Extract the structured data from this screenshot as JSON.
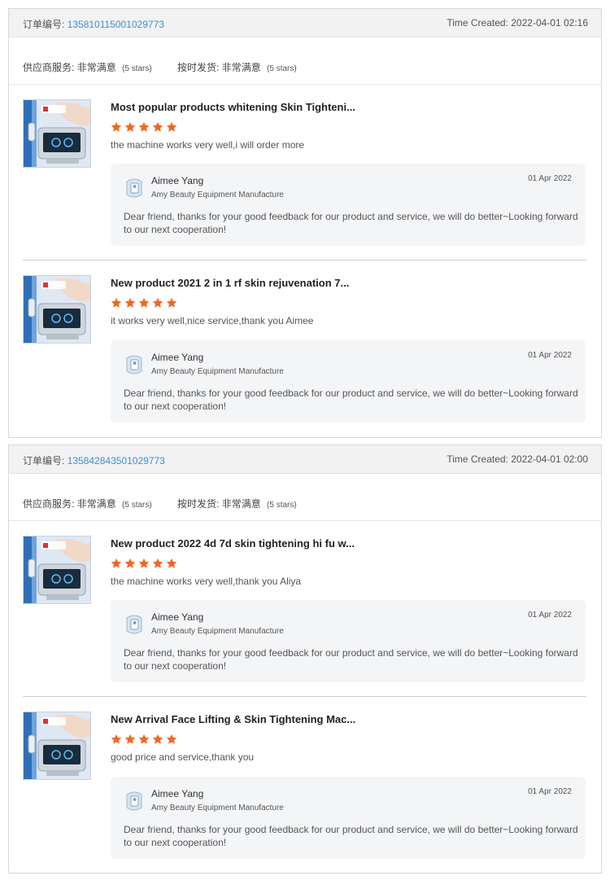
{
  "labels": {
    "order_no_label": "订单编号:",
    "time_created_label": "Time Created:",
    "supplier_service_label": "供应商服务:",
    "on_time_shipping_label": "按时发货:"
  },
  "orders": [
    {
      "order_no": "135810115001029773",
      "time_created": "2022-04-01 02:16",
      "supplier_service": {
        "value": "非常满意",
        "stars_text": "(5 stars)"
      },
      "on_time_shipping": {
        "value": "非常满意",
        "stars_text": "(5 stars)"
      },
      "reviews": [
        {
          "title": "Most popular products whitening Skin Tighteni...",
          "rating": 5,
          "text": "the machine works very well,i will order more",
          "reply": {
            "name": "Aimee Yang",
            "company": "Amy Beauty Equipment Manufacture",
            "date": "01 Apr 2022",
            "message": "Dear friend, thanks for your good feedback for our product and service, we will do better~Looking forward to our next cooperation!"
          }
        },
        {
          "title": "New product 2021 2 in 1 rf skin rejuvenation 7...",
          "rating": 5,
          "text": "it works very well,nice service,thank you Aimee",
          "reply": {
            "name": "Aimee Yang",
            "company": "Amy Beauty Equipment Manufacture",
            "date": "01 Apr 2022",
            "message": "Dear friend, thanks for your good feedback for our product and service, we will do better~Looking forward to our next cooperation!"
          }
        }
      ]
    },
    {
      "order_no": "135842843501029773",
      "time_created": "2022-04-01 02:00",
      "supplier_service": {
        "value": "非常满意",
        "stars_text": "(5 stars)"
      },
      "on_time_shipping": {
        "value": "非常满意",
        "stars_text": "(5 stars)"
      },
      "reviews": [
        {
          "title": "New product 2022 4d 7d skin tightening hi fu w...",
          "rating": 5,
          "text": "the machine works very well,thank you Aliya",
          "reply": {
            "name": "Aimee Yang",
            "company": "Amy Beauty Equipment Manufacture",
            "date": "01 Apr 2022",
            "message": "Dear friend, thanks for your good feedback for our product and service, we will do better~Looking forward to our next cooperation!"
          }
        },
        {
          "title": "New Arrival Face Lifting & Skin Tightening Mac...",
          "rating": 5,
          "text": "good price and service,thank you",
          "reply": {
            "name": "Aimee Yang",
            "company": "Amy Beauty Equipment Manufacture",
            "date": "01 Apr 2022",
            "message": "Dear friend, thanks for your good feedback for our product and service, we will do better~Looking forward to our next cooperation!"
          }
        }
      ]
    }
  ],
  "icons": {
    "star": "star-icon",
    "avatar": "supplier-avatar-icon",
    "product": "product-thumbnail"
  },
  "colors": {
    "star": "#f26722",
    "order_link": "#3d8fd6",
    "reply_bg": "#f4f5f7",
    "header_bg": "#f2f2f2"
  }
}
